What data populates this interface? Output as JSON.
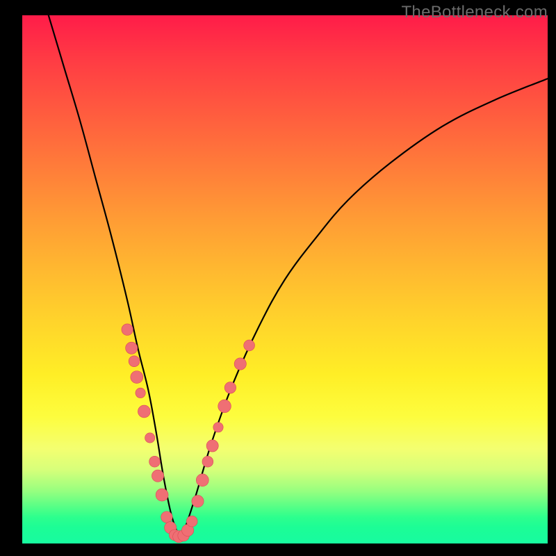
{
  "watermark": "TheBottleneck.com",
  "chart_data": {
    "type": "line",
    "title": "",
    "xlabel": "",
    "ylabel": "",
    "xlim": [
      0,
      100
    ],
    "ylim": [
      0,
      100
    ],
    "grid": false,
    "series": [
      {
        "name": "curve",
        "color": "#000000",
        "x": [
          5,
          8,
          11,
          14,
          17,
          20,
          22,
          24,
          25.5,
          27,
          28.5,
          30,
          31,
          33,
          36,
          40,
          45,
          50,
          56,
          62,
          70,
          80,
          90,
          100
        ],
        "y": [
          100,
          90,
          80,
          69,
          58,
          46,
          37,
          29,
          21,
          12,
          5,
          1.5,
          3,
          9,
          19,
          30,
          41,
          50,
          58,
          65,
          72,
          79,
          84,
          88
        ]
      }
    ],
    "markers": [
      {
        "x": 20.0,
        "y": 40.5,
        "r": 1.15
      },
      {
        "x": 20.8,
        "y": 37.0,
        "r": 1.2
      },
      {
        "x": 21.3,
        "y": 34.5,
        "r": 1.1
      },
      {
        "x": 21.8,
        "y": 31.5,
        "r": 1.25
      },
      {
        "x": 22.5,
        "y": 28.5,
        "r": 1.0
      },
      {
        "x": 23.2,
        "y": 25.0,
        "r": 1.25
      },
      {
        "x": 24.3,
        "y": 20.0,
        "r": 1.0
      },
      {
        "x": 25.2,
        "y": 15.5,
        "r": 1.1
      },
      {
        "x": 25.8,
        "y": 12.8,
        "r": 1.2
      },
      {
        "x": 26.6,
        "y": 9.2,
        "r": 1.25
      },
      {
        "x": 27.5,
        "y": 5.0,
        "r": 1.15
      },
      {
        "x": 28.2,
        "y": 3.0,
        "r": 1.2
      },
      {
        "x": 29.0,
        "y": 1.6,
        "r": 1.1
      },
      {
        "x": 29.8,
        "y": 1.3,
        "r": 1.2
      },
      {
        "x": 30.7,
        "y": 1.5,
        "r": 1.15
      },
      {
        "x": 31.5,
        "y": 2.5,
        "r": 1.2
      },
      {
        "x": 32.3,
        "y": 4.2,
        "r": 1.1
      },
      {
        "x": 33.4,
        "y": 8.0,
        "r": 1.2
      },
      {
        "x": 34.3,
        "y": 12.0,
        "r": 1.25
      },
      {
        "x": 35.3,
        "y": 15.5,
        "r": 1.1
      },
      {
        "x": 36.2,
        "y": 18.5,
        "r": 1.2
      },
      {
        "x": 37.3,
        "y": 22.0,
        "r": 1.0
      },
      {
        "x": 38.5,
        "y": 26.0,
        "r": 1.3
      },
      {
        "x": 39.6,
        "y": 29.5,
        "r": 1.15
      },
      {
        "x": 41.5,
        "y": 34.0,
        "r": 1.2
      },
      {
        "x": 43.2,
        "y": 37.5,
        "r": 1.1
      }
    ],
    "marker_style": {
      "fill": "#ef6f74",
      "stroke": "#d94b54"
    }
  }
}
